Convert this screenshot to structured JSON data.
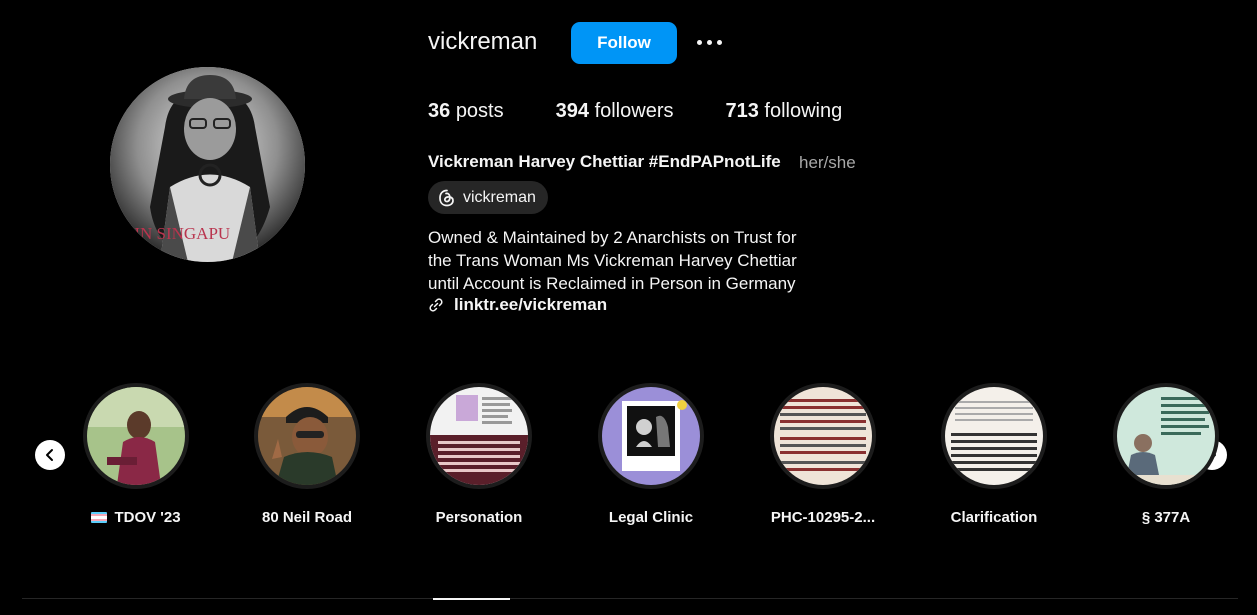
{
  "profile": {
    "username": "vickreman",
    "follow_label": "Follow",
    "posts_count": "36",
    "posts_label": "posts",
    "followers_count": "394",
    "followers_label": "followers",
    "following_count": "713",
    "following_label": "following",
    "full_name": "Vickreman Harvey Chettiar #EndPAPnotLife",
    "pronouns": "her/she",
    "threads_handle": "vickreman",
    "bio_lines": [
      "Owned & Maintained by 2 Anarchists on Trust for",
      "the Trans Woman Ms Vickreman Harvey Chettiar",
      "until Account is Reclaimed in Person in Germany"
    ],
    "link": "linktr.ee/vickreman",
    "avatar_caption": "T IN SINGAPU"
  },
  "highlights": [
    {
      "label": "TDOV '23",
      "has_flag": true
    },
    {
      "label": "80 Neil Road"
    },
    {
      "label": "Personation"
    },
    {
      "label": "Legal Clinic"
    },
    {
      "label": "PHC-10295-2..."
    },
    {
      "label": "Clarification"
    },
    {
      "label": "§ 377A"
    }
  ],
  "colors": {
    "background": "#000000",
    "follow_button": "#0095f6",
    "chip": "#262626",
    "muted_text": "#a8a8a8",
    "trans_flag": [
      "#5bcefa",
      "#f5a9b8",
      "#ffffff",
      "#f5a9b8",
      "#5bcefa"
    ]
  },
  "icons": {
    "more": "more-icon",
    "threads": "threads-icon",
    "link": "link-icon",
    "prev": "chevron-left-icon",
    "next": "chevron-right-icon"
  }
}
